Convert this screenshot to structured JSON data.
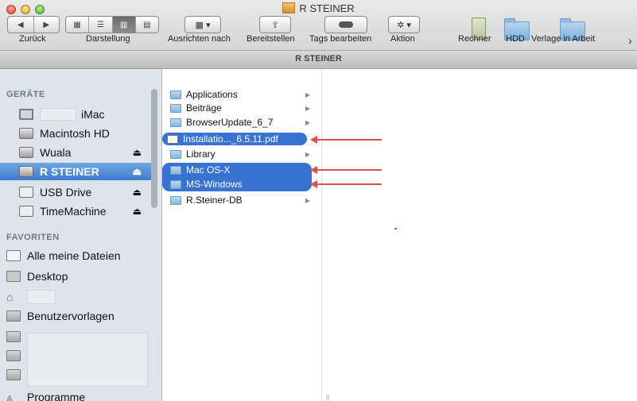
{
  "window": {
    "title": "R STEINER",
    "path_title": "R STEINER"
  },
  "toolbar": {
    "back_label": "Zurück",
    "view_label": "Darstellung",
    "arrange_label": "Ausrichten nach",
    "share_label": "Bereitstellen",
    "tags_label": "Tags bearbeiten",
    "action_label": "Aktion",
    "shortcuts": [
      {
        "label": "Rechner",
        "icon": "calculator-icon"
      },
      {
        "label": "HDD",
        "icon": "folder-icon"
      },
      {
        "label": "Verlage in Arbeit",
        "icon": "folder-icon"
      }
    ]
  },
  "sidebar": {
    "devices_header": "GERÄTE",
    "devices": [
      {
        "label": "iMac",
        "icon": "monitor-icon"
      },
      {
        "label": "Macintosh HD",
        "icon": "disk-icon"
      },
      {
        "label": "Wuala",
        "icon": "disk-icon",
        "eject": "⏏"
      },
      {
        "label": "R STEINER",
        "icon": "disk-icon",
        "eject": "⏏",
        "selected": true
      },
      {
        "label": "USB Drive",
        "icon": "disk-icon",
        "eject": "⏏"
      },
      {
        "label": "TimeMachine",
        "icon": "disk-icon",
        "eject": "⏏"
      }
    ],
    "favorites_header": "FAVORITEN",
    "favorites": [
      {
        "label": "Alle meine Dateien",
        "icon": "all-files-icon"
      },
      {
        "label": "Desktop",
        "icon": "desktop-icon"
      },
      {
        "label": "",
        "icon": "home-icon"
      },
      {
        "label": "Benutzervorlagen",
        "icon": "folder-icon"
      },
      {
        "label": "",
        "icon": "folder-icon"
      },
      {
        "label": "",
        "icon": "folder-icon"
      },
      {
        "label": "",
        "icon": "folder-icon"
      },
      {
        "label": "Programme",
        "icon": "applications-icon"
      }
    ]
  },
  "files": [
    {
      "name": "Applications",
      "kind": "folder"
    },
    {
      "name": "Beiträge",
      "kind": "folder"
    },
    {
      "name": "BrowserUpdate_6_7",
      "kind": "folder"
    },
    {
      "name": "Installatio..._6.5.11.pdf",
      "kind": "pdf",
      "selected": true
    },
    {
      "name": "Library",
      "kind": "folder"
    },
    {
      "name": "Mac OS-X",
      "kind": "folder",
      "selected": true
    },
    {
      "name": "MS-Windows",
      "kind": "folder",
      "selected": true
    },
    {
      "name": "R.Steiner-DB",
      "kind": "folder"
    }
  ],
  "colors": {
    "selection": "#3873d1",
    "annotation_arrow": "#e44d4d",
    "sidebar_bg": "#dde4ec"
  }
}
